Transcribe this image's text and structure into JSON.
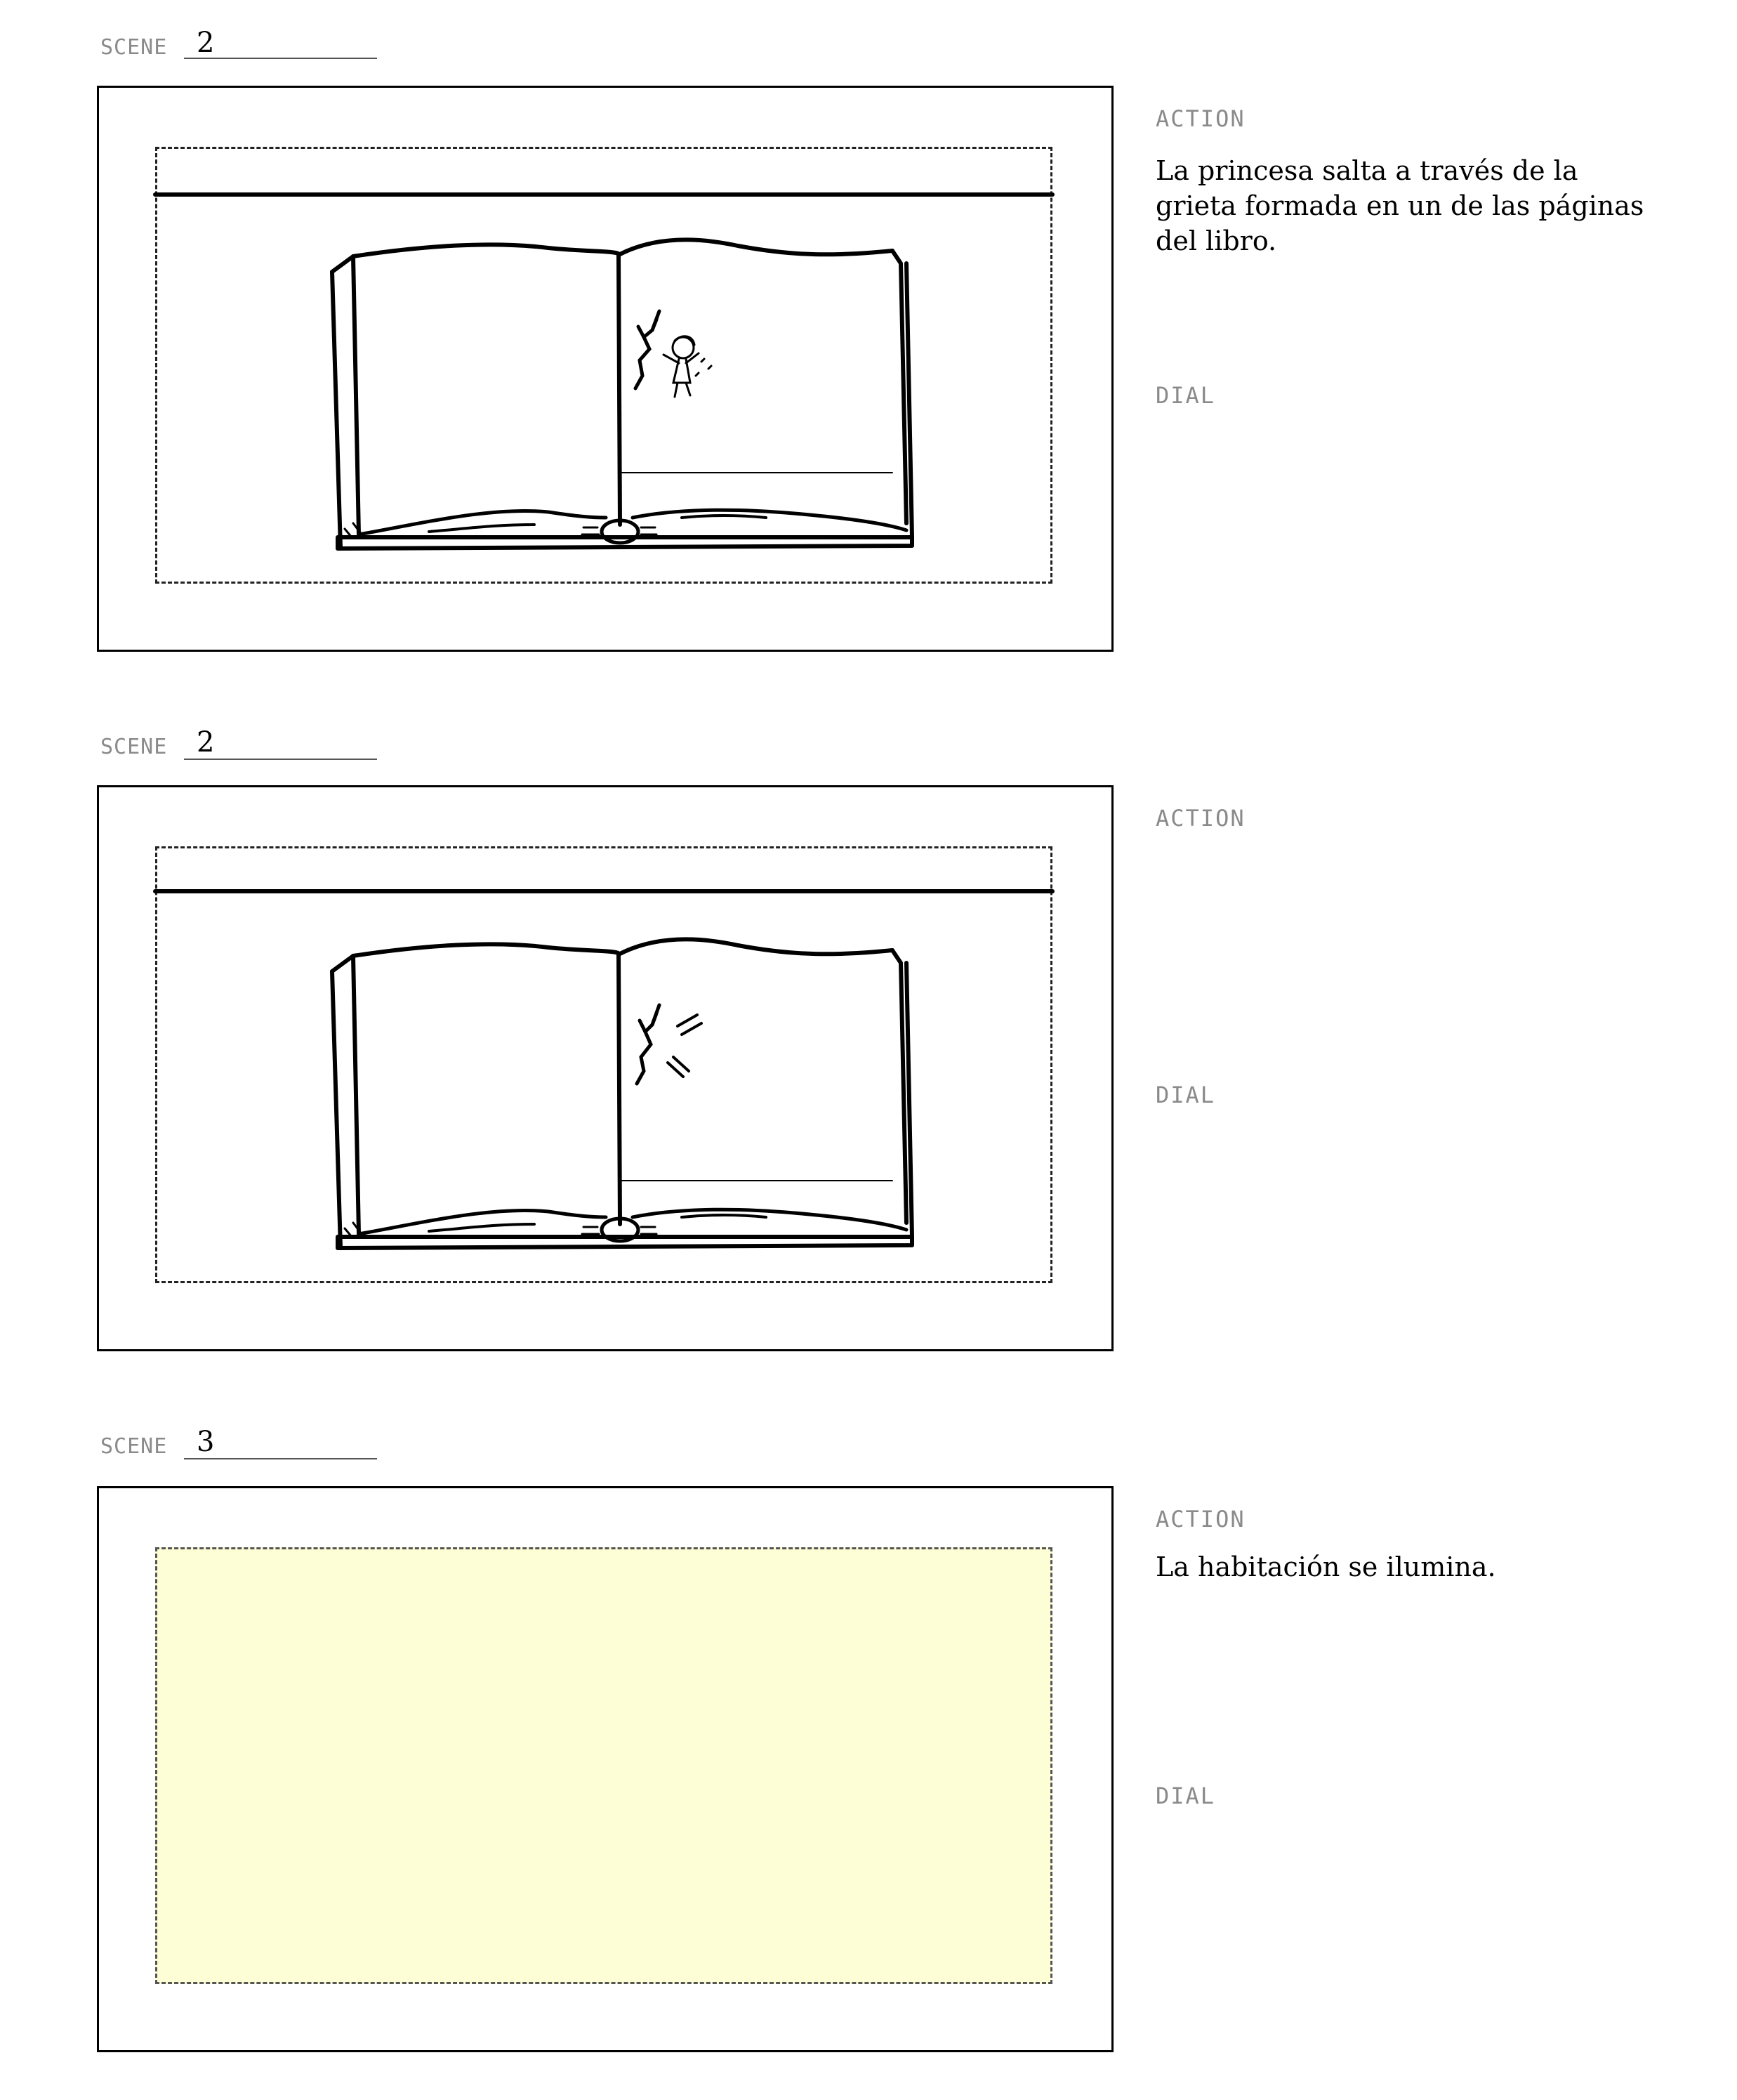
{
  "labels": {
    "scene": "SCENE",
    "action": "ACTION",
    "dial": "DIAL"
  },
  "panels": [
    {
      "scene_number": "2",
      "action_text": "La princesa salta a través de la grieta formada en un de las páginas del libro.",
      "dial_text": ""
    },
    {
      "scene_number": "2",
      "action_text": "",
      "dial_text": ""
    },
    {
      "scene_number": "3",
      "action_text": "La habitación se ilumina.",
      "dial_text": ""
    }
  ],
  "colors": {
    "lit_room": "#fdfdd6",
    "label_gray": "#8a8a8a"
  },
  "icons": [
    "open-book-drawing",
    "crack-drawing",
    "princess-figure",
    "light-burst-marks"
  ]
}
